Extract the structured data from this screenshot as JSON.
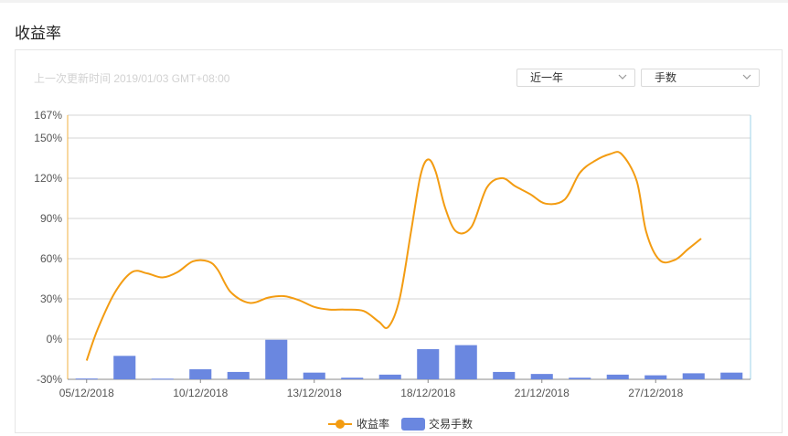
{
  "page": {
    "section_title": "收益率"
  },
  "card": {
    "updated_text": "上一次更新时间 2019/01/03 GMT+08:00"
  },
  "controls": {
    "period": {
      "value": "近一年"
    },
    "metric": {
      "value": "手数"
    }
  },
  "colors": {
    "line": "#f39c12",
    "bar": "#6a87e0",
    "grid": "#d6d6d6",
    "axis_left": "#f0b240",
    "axis_right": "#9dd3e8"
  },
  "chart_data": {
    "type": "bar+line",
    "x_tick_labels": [
      "05/12/2018",
      "10/12/2018",
      "13/12/2018",
      "18/12/2018",
      "21/12/2018",
      "27/12/2018"
    ],
    "y_tick_labels": [
      "167%",
      "150%",
      "120%",
      "90%",
      "60%",
      "30%",
      "0%",
      "-30%"
    ],
    "y_ticks": [
      167,
      150,
      120,
      90,
      60,
      30,
      0,
      -30
    ],
    "ylim": [
      -30,
      167
    ],
    "grid": true,
    "legend_position": "bottom-center",
    "series": [
      {
        "name": "收益率",
        "type": "line",
        "points": [
          [
            0,
            -16
          ],
          [
            0.3,
            8
          ],
          [
            0.75,
            35
          ],
          [
            1.2,
            50
          ],
          [
            1.6,
            49
          ],
          [
            2.0,
            46
          ],
          [
            2.4,
            50
          ],
          [
            2.8,
            58
          ],
          [
            3.2,
            58
          ],
          [
            3.45,
            52
          ],
          [
            3.8,
            35
          ],
          [
            4.3,
            27
          ],
          [
            4.8,
            31
          ],
          [
            5.2,
            32
          ],
          [
            5.6,
            29
          ],
          [
            6.0,
            24
          ],
          [
            6.4,
            22
          ],
          [
            6.8,
            22
          ],
          [
            7.3,
            21
          ],
          [
            7.7,
            13
          ],
          [
            7.95,
            9
          ],
          [
            8.25,
            30
          ],
          [
            8.55,
            80
          ],
          [
            8.8,
            122
          ],
          [
            9.0,
            134
          ],
          [
            9.2,
            125
          ],
          [
            9.45,
            98
          ],
          [
            9.75,
            80
          ],
          [
            10.15,
            84
          ],
          [
            10.55,
            113
          ],
          [
            10.95,
            120
          ],
          [
            11.3,
            114
          ],
          [
            11.7,
            108
          ],
          [
            12.1,
            101
          ],
          [
            12.6,
            104
          ],
          [
            13.0,
            124
          ],
          [
            13.4,
            133
          ],
          [
            13.8,
            138
          ],
          [
            14.1,
            138
          ],
          [
            14.5,
            118
          ],
          [
            14.75,
            80
          ],
          [
            15.1,
            59
          ],
          [
            15.5,
            59
          ],
          [
            15.85,
            67
          ],
          [
            16.2,
            75
          ]
        ]
      },
      {
        "name": "交易手数",
        "type": "bar",
        "baseline": -30,
        "values": [
          -29.4,
          -12.5,
          -29.5,
          -22.5,
          -24.5,
          -0.5,
          -25,
          -28.8,
          -26.5,
          -7.5,
          -4.5,
          -24.5,
          -26,
          -28.8,
          -26.5,
          -27,
          -25.5,
          -25
        ]
      }
    ]
  }
}
